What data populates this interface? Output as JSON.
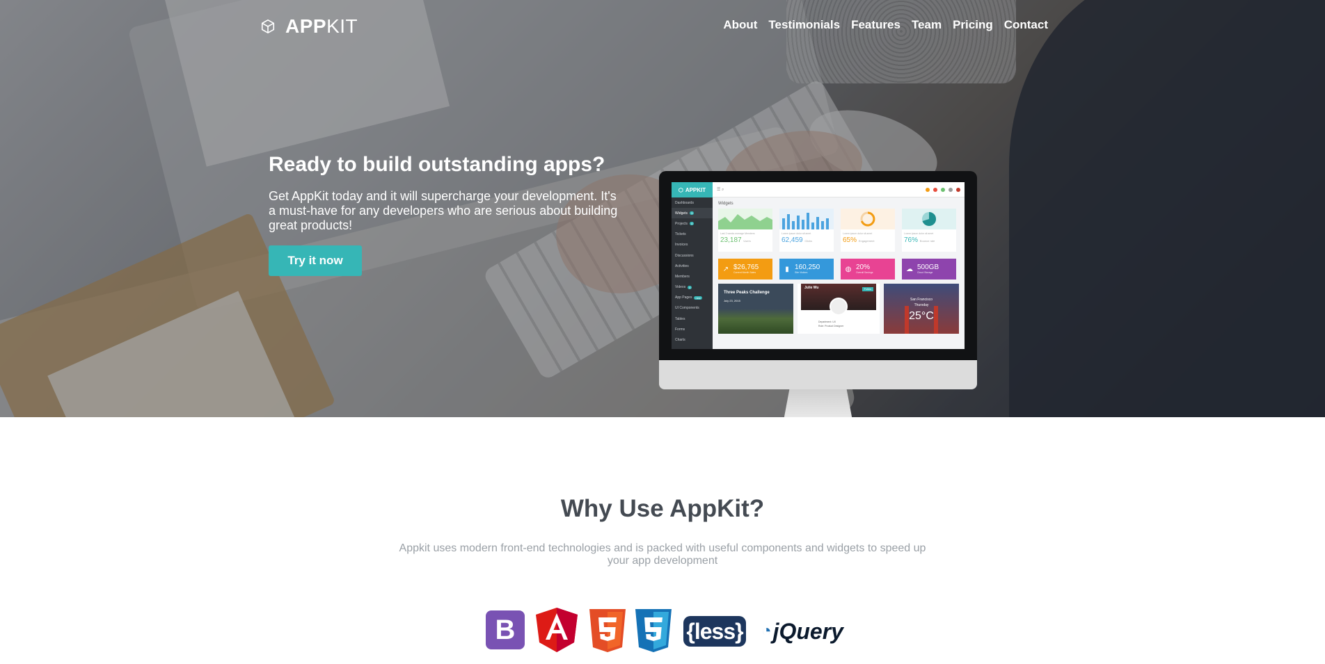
{
  "nav": {
    "brand_bold": "APP",
    "brand_light": "KIT",
    "links": [
      "About",
      "Testimonials",
      "Features",
      "Team",
      "Pricing",
      "Contact"
    ]
  },
  "hero": {
    "title": "Ready to build outstanding apps?",
    "text": "Get AppKit today and it will supercharge your development. It's a must-have for any developers who are serious about building great products!",
    "cta_label": "Try it now"
  },
  "mockup": {
    "brand": "APPKIT",
    "sidebar_items": [
      {
        "label": "Dashboards",
        "badge": ""
      },
      {
        "label": "Widgets",
        "badge": "3"
      },
      {
        "label": "Projects",
        "badge": "4"
      },
      {
        "label": "Tickets",
        "badge": ""
      },
      {
        "label": "Invoices",
        "badge": ""
      },
      {
        "label": "Discussions",
        "badge": ""
      },
      {
        "label": "Activities",
        "badge": ""
      },
      {
        "label": "Members",
        "badge": ""
      },
      {
        "label": "Videos",
        "badge": "4"
      },
      {
        "label": "App Pages",
        "badge": "new"
      },
      {
        "label": "UI Components",
        "badge": ""
      },
      {
        "label": "Tables",
        "badge": ""
      },
      {
        "label": "Forms",
        "badge": ""
      },
      {
        "label": "Charts",
        "badge": ""
      }
    ],
    "section_title": "Widgets",
    "cards": [
      {
        "caption": "Last 2 weeks average Members",
        "value": "23,187",
        "unit": "Users",
        "color": "#6cc070"
      },
      {
        "caption": "Lorem ipsum dolor sit amet",
        "value": "62,459",
        "unit": "Clicks",
        "color": "#4aa3df"
      },
      {
        "caption": "Lorem ipsum dolor sit amet",
        "value": "65%",
        "unit": "Engagement",
        "color": "#f39c12"
      },
      {
        "caption": "Lorem ipsum dolor sit amet",
        "value": "76%",
        "unit": "Bounce rate",
        "color": "#36b6b6"
      }
    ],
    "stats": [
      {
        "value": "$26,765",
        "label": "Current Month Sales",
        "color": "#f39c12",
        "icon": "chart-icon"
      },
      {
        "value": "160,250",
        "label": "Site Visitors",
        "color": "#3498db",
        "icon": "bar-icon"
      },
      {
        "value": "20%",
        "label": "Overall Savings",
        "color": "#e84393",
        "icon": "piggy-icon"
      },
      {
        "value": "500GB",
        "label": "Cloud Storage",
        "color": "#8e44ad",
        "icon": "cloud-icon"
      }
    ],
    "challenge": {
      "title": "Three Peaks Challenge",
      "date": "July 23, 2015"
    },
    "profile": {
      "name": "Julie Wu",
      "follow": "Follow",
      "department": "Department: UX",
      "role": "Role: Product Designer"
    },
    "weather": {
      "city": "San Francisco",
      "day": "Thursday",
      "temp": "25°C"
    }
  },
  "why": {
    "title": "Why Use AppKit?",
    "text": "Appkit uses modern front-end technologies and is packed with useful components and widgets to speed up your app development",
    "tech_logos": {
      "bootstrap": "B",
      "less": "{less}",
      "jquery": "jQuery"
    }
  },
  "colors": {
    "accent": "#36b6b6",
    "heading": "#444a52",
    "muted": "#9aa0a6"
  }
}
